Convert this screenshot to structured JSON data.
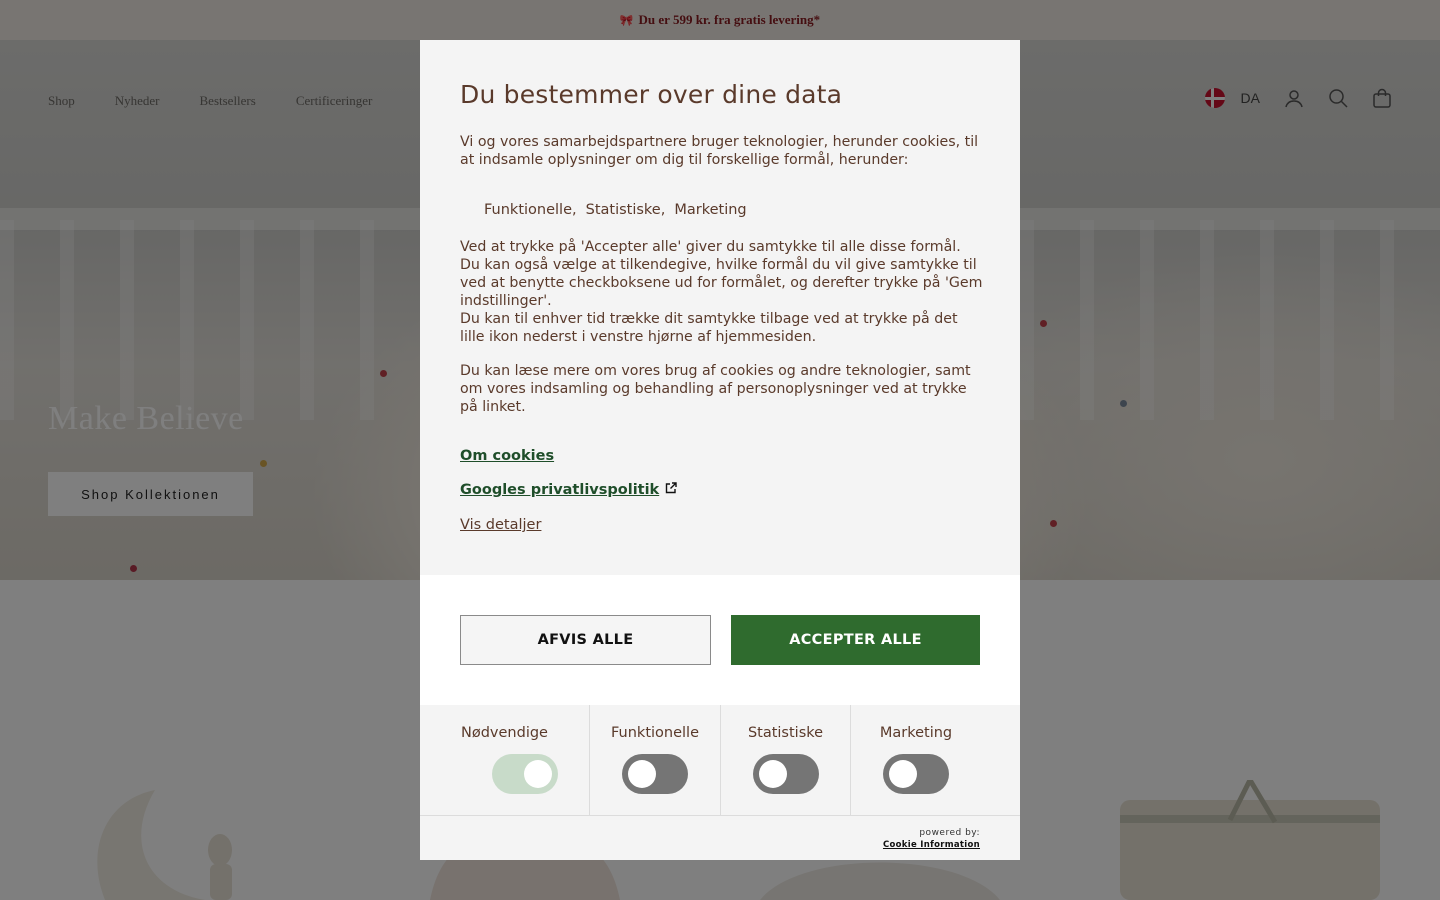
{
  "announcement": {
    "text": "Du er 599 kr. fra gratis levering*"
  },
  "nav": {
    "items": [
      "Shop",
      "Nyheder",
      "Bestsellers",
      "Certificeringer"
    ],
    "language": "DA"
  },
  "hero": {
    "title": "Make Believe",
    "button_label": "Shop Kollektionen"
  },
  "consent": {
    "title": "Du bestemmer over dine data",
    "intro": "Vi og vores samarbejdspartnere bruger teknologier, herunder cookies, til at indsamle oplysninger om dig til forskellige formål, herunder:",
    "purposes": [
      "Funktionelle,",
      "Statistiske,",
      "Marketing"
    ],
    "body1": "Ved at trykke på 'Accepter alle' giver du samtykke til alle disse formål. Du kan også vælge at tilkendegive, hvilke formål du vil give samtykke til ved at benytte checkboksene ud for formålet, og derefter trykke på 'Gem indstillinger'.",
    "body2": "Du kan til enhver tid trække dit samtykke tilbage ved at trykke på det lille ikon nederst i venstre hjørne af hjemmesiden.",
    "body3": "Du kan læse mere om vores brug af cookies og andre teknologier, samt om vores indsamling og behandling af personoplysninger ved at trykke på linket.",
    "link_cookies": "Om cookies",
    "link_google": "Googles privatlivspolitik",
    "link_details": "Vis detaljer",
    "reject_label": "AFVIS ALLE",
    "accept_label": "ACCEPTER ALLE",
    "categories": [
      {
        "label": "Nødvendige",
        "enabled": true
      },
      {
        "label": "Funktionelle",
        "enabled": false
      },
      {
        "label": "Statistiske",
        "enabled": false
      },
      {
        "label": "Marketing",
        "enabled": false
      }
    ],
    "powered_by": "powered by:",
    "powered_by_brand": "Cookie Information",
    "accent_color": "#2f6b2e"
  }
}
